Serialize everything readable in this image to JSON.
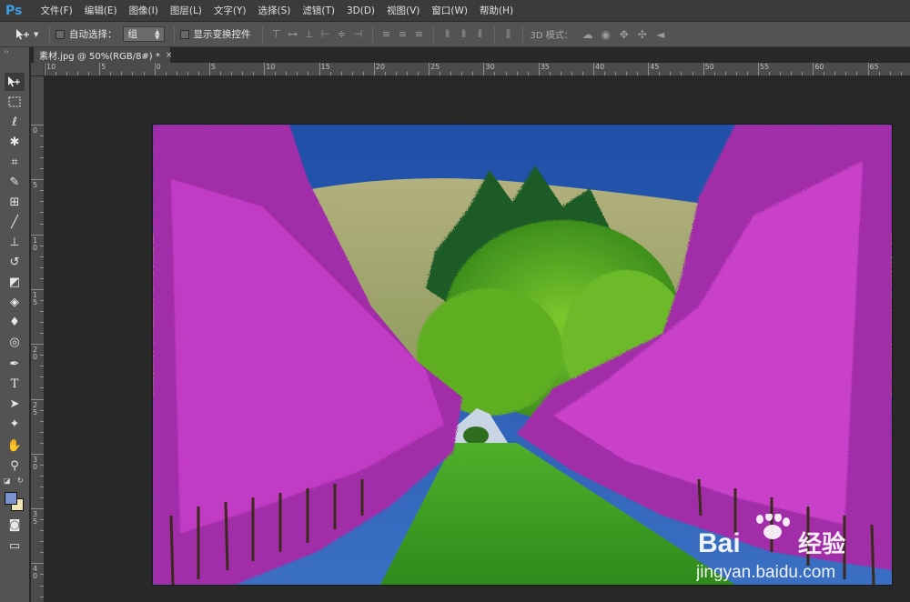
{
  "app": {
    "logo": "Ps"
  },
  "menu": [
    {
      "label": "文件(F)"
    },
    {
      "label": "编辑(E)"
    },
    {
      "label": "图像(I)"
    },
    {
      "label": "图层(L)"
    },
    {
      "label": "文字(Y)"
    },
    {
      "label": "选择(S)"
    },
    {
      "label": "滤镜(T)"
    },
    {
      "label": "3D(D)"
    },
    {
      "label": "视图(V)"
    },
    {
      "label": "窗口(W)"
    },
    {
      "label": "帮助(H)"
    }
  ],
  "options": {
    "tool_icon": "move-tool-icon",
    "auto_select_label": "自动选择：",
    "auto_select_value": "组",
    "show_transform_label": "显示变换控件",
    "mode3d_label": "3D 模式："
  },
  "document": {
    "tab_title": "素材.jpg @ 50%(RGB/8#) *",
    "close_glyph": "×"
  },
  "ruler": {
    "top_labels": [
      "10",
      "5",
      "0",
      "5",
      "10",
      "15",
      "20",
      "25",
      "30",
      "35",
      "40",
      "45",
      "50",
      "55",
      "60",
      "65"
    ],
    "left_labels": [
      "0",
      "5",
      "10",
      "15",
      "20",
      "25",
      "30",
      "35",
      "40"
    ]
  },
  "colors": {
    "foreground": "#7a93cc",
    "background": "#f4e6b4"
  },
  "watermark": {
    "brand": "Bai",
    "brand_suffix": "经验",
    "url": "jingyan.baidu.com"
  }
}
